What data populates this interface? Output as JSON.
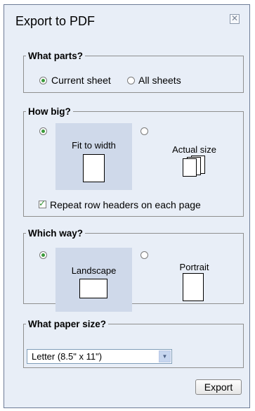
{
  "dialog": {
    "title": "Export to PDF",
    "close_glyph": "✕"
  },
  "parts": {
    "legend": "What parts?",
    "options": [
      {
        "label": "Current sheet",
        "selected": true
      },
      {
        "label": "All sheets",
        "selected": false
      }
    ]
  },
  "size": {
    "legend": "How big?",
    "options": [
      {
        "label": "Fit to width",
        "selected": true
      },
      {
        "label": "Actual size",
        "selected": false
      }
    ],
    "repeat_headers": {
      "label": "Repeat row headers on each page",
      "checked": true
    }
  },
  "orientation": {
    "legend": "Which way?",
    "options": [
      {
        "label": "Landscape",
        "selected": true
      },
      {
        "label": "Portrait",
        "selected": false
      }
    ]
  },
  "paper": {
    "legend": "What paper size?",
    "selected": "Letter (8.5\" x 11\")"
  },
  "actions": {
    "export_label": "Export"
  },
  "colors": {
    "dialog_bg": "#e8eef7",
    "selected_option_bg": "#cfd9ea",
    "check_green": "#3a9a3a"
  }
}
